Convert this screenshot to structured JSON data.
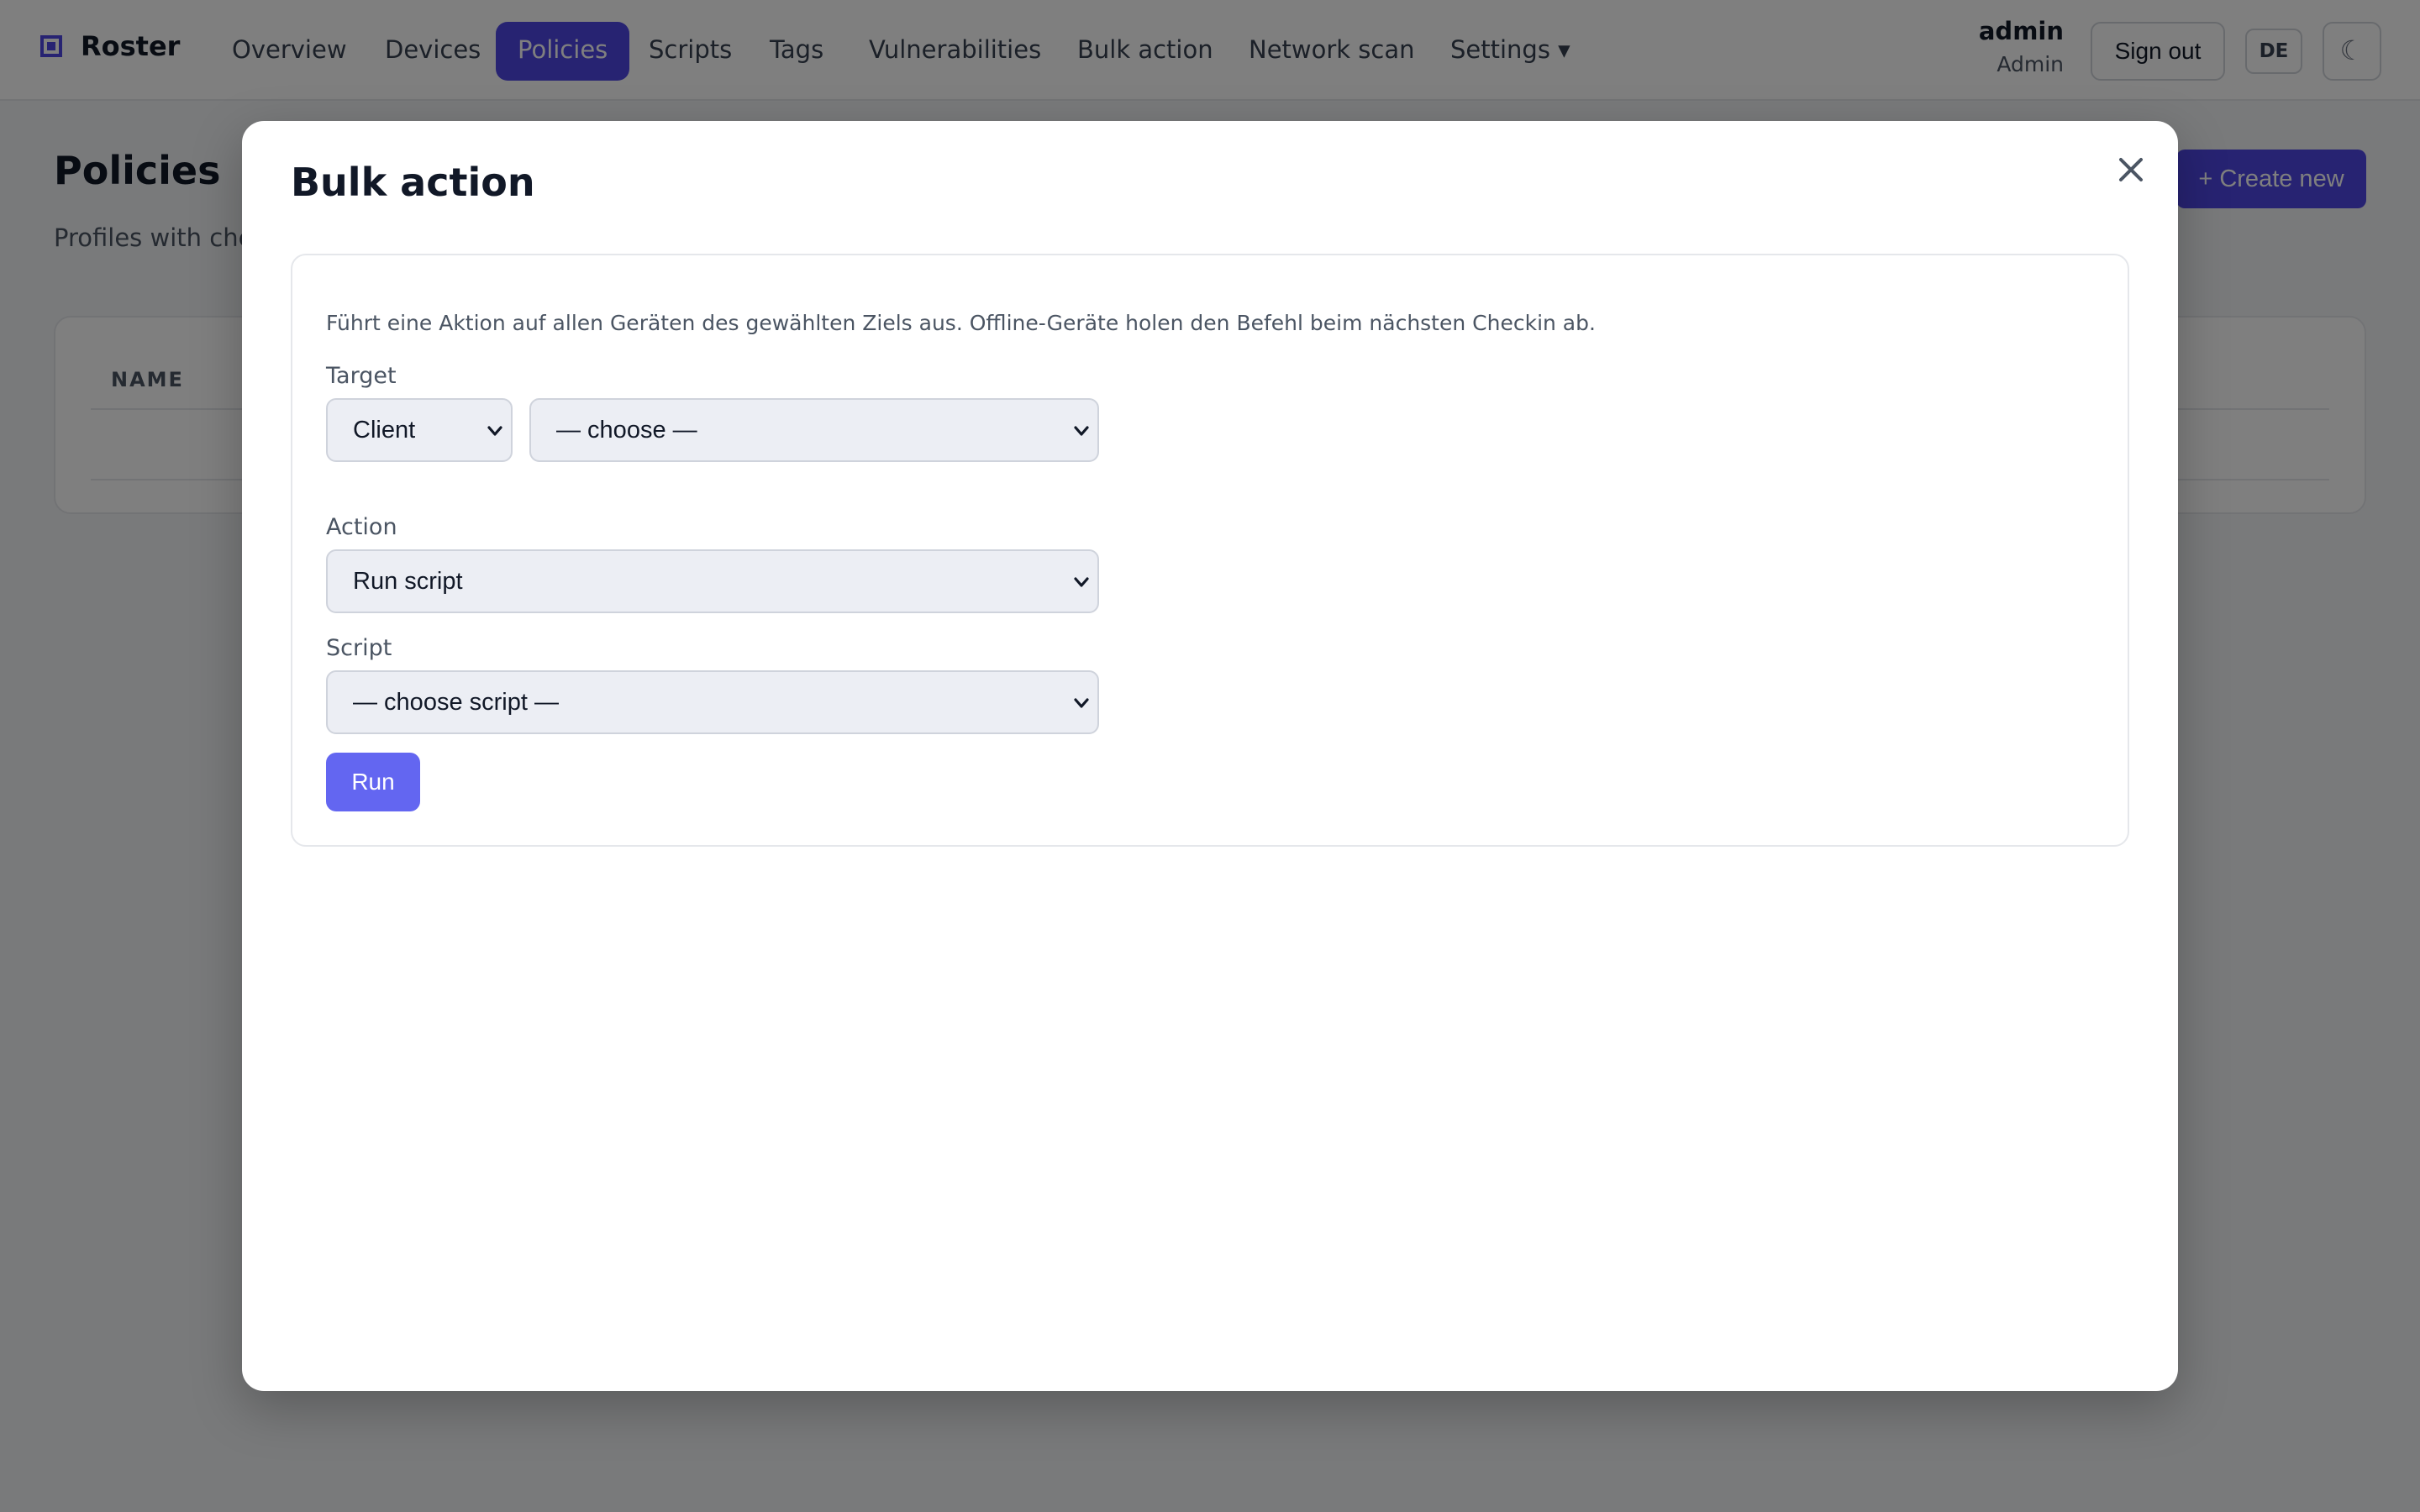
{
  "app": {
    "brand": "Roster",
    "brand_color": "#4f46e5"
  },
  "nav": {
    "items": [
      {
        "label": "Overview"
      },
      {
        "label": "Devices"
      },
      {
        "label": "Policies"
      },
      {
        "label": "Scripts"
      },
      {
        "label": "Tags"
      },
      {
        "label": "Vulnerabilities"
      },
      {
        "label": "Bulk action"
      },
      {
        "label": "Network scan"
      },
      {
        "label": "Settings ▾"
      }
    ],
    "active": "Policies"
  },
  "user": {
    "name": "admin",
    "role": "Admin",
    "sign_out_label": "Sign out",
    "language_label": "DE",
    "theme_toggle_symbol": "☾"
  },
  "page": {
    "title": "Policies",
    "subtitle": "Profiles with checks",
    "create_label": "+ Create new",
    "table": {
      "headers": [
        "NAME"
      ]
    }
  },
  "modal": {
    "title": "Bulk action",
    "description": "Führt eine Aktion auf allen Geräten des gewählten Ziels aus. Offline-Geräte holen den Befehl beim nächsten Checkin ab.",
    "target": {
      "label": "Target",
      "type_value": "Client",
      "item_value": "— choose —"
    },
    "action": {
      "label": "Action",
      "value": "Run script"
    },
    "script": {
      "label": "Script",
      "value": "— choose script —"
    },
    "run_label": "Run",
    "accent_color": "#6366f1"
  }
}
